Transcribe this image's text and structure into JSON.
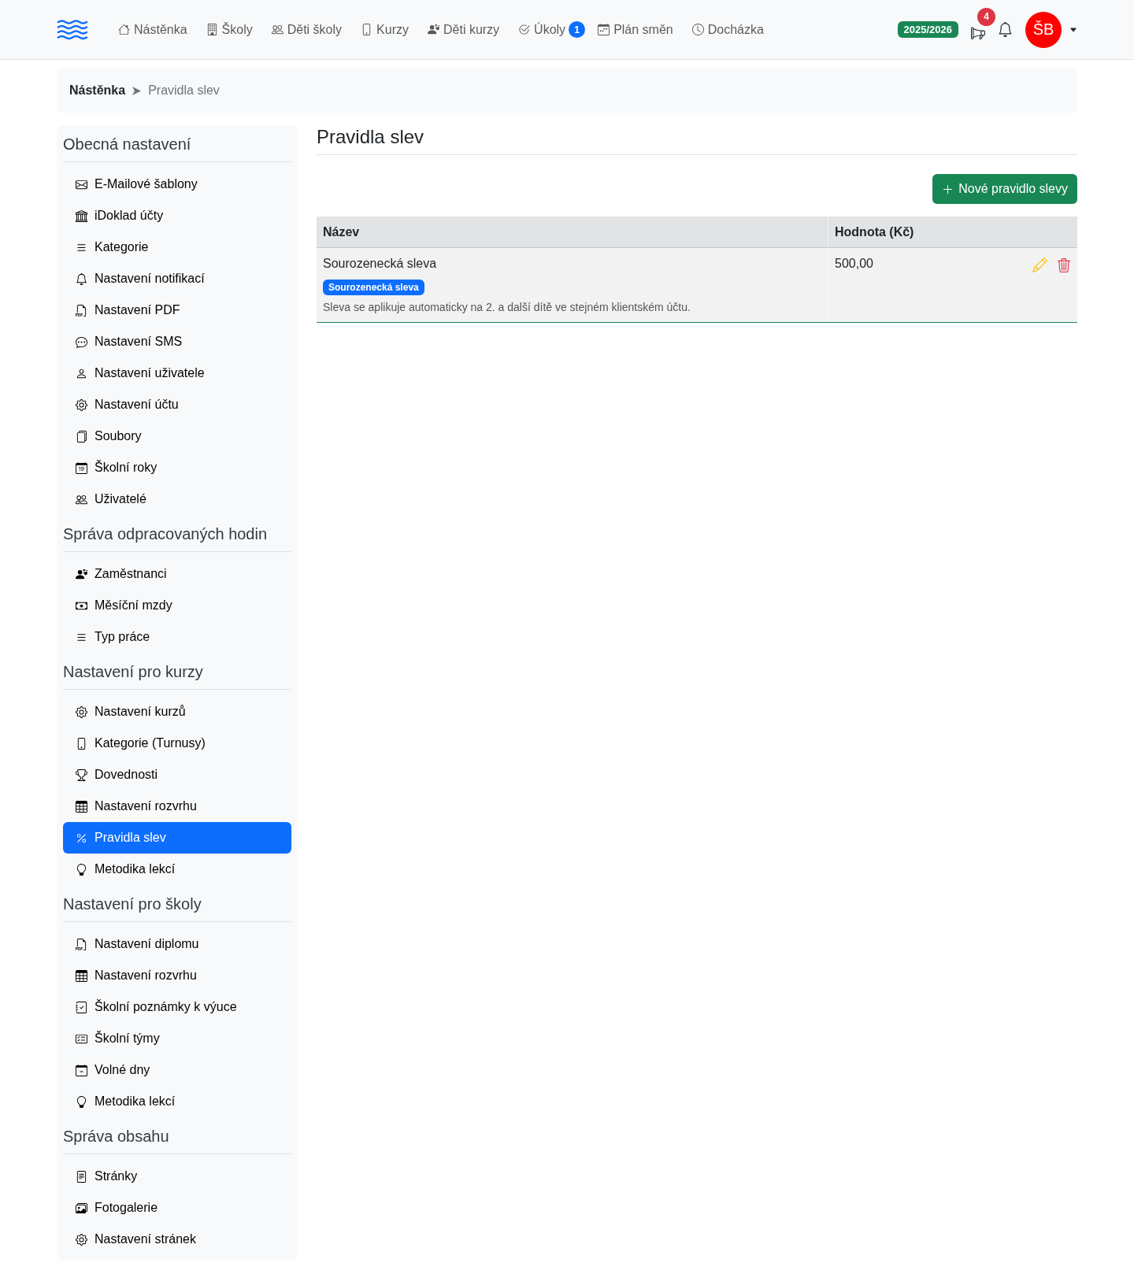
{
  "navbar": {
    "items": [
      {
        "label": "Nástěnka"
      },
      {
        "label": "Školy"
      },
      {
        "label": "Děti školy"
      },
      {
        "label": "Kurzy"
      },
      {
        "label": "Děti kurzy"
      },
      {
        "label": "Úkoly",
        "badge": "1"
      },
      {
        "label": "Plán směn"
      },
      {
        "label": "Docházka"
      }
    ],
    "school_year": "2025/2026",
    "announcements_count": "4",
    "avatar_initials": "ŠB"
  },
  "breadcrumb": [
    {
      "label": "Nástěnka",
      "active": false
    },
    {
      "label": "Pravidla slev",
      "active": true
    }
  ],
  "sidebar": {
    "sections": [
      {
        "title": "Obecná nastavení",
        "items": [
          {
            "label": "E-Mailové šablony",
            "selected": false
          },
          {
            "label": "iDoklad účty",
            "selected": false
          },
          {
            "label": "Kategorie",
            "selected": false
          },
          {
            "label": "Nastavení notifikací",
            "selected": false
          },
          {
            "label": "Nastavení PDF",
            "selected": false
          },
          {
            "label": "Nastavení SMS",
            "selected": false
          },
          {
            "label": "Nastavení uživatele",
            "selected": false
          },
          {
            "label": "Nastavení účtu",
            "selected": false
          },
          {
            "label": "Soubory",
            "selected": false
          },
          {
            "label": "Školní roky",
            "selected": false
          },
          {
            "label": "Uživatelé",
            "selected": false
          }
        ]
      },
      {
        "title": "Správa odpracovaných hodin",
        "items": [
          {
            "label": "Zaměstnanci",
            "selected": false
          },
          {
            "label": "Měsíční mzdy",
            "selected": false
          },
          {
            "label": "Typ práce",
            "selected": false
          }
        ]
      },
      {
        "title": "Nastavení pro kurzy",
        "items": [
          {
            "label": "Nastavení kurzů",
            "selected": false
          },
          {
            "label": "Kategorie (Turnusy)",
            "selected": false
          },
          {
            "label": "Dovednosti",
            "selected": false
          },
          {
            "label": "Nastavení rozvrhu",
            "selected": false
          },
          {
            "label": "Pravidla slev",
            "selected": true
          },
          {
            "label": "Metodika lekcí",
            "selected": false
          }
        ]
      },
      {
        "title": "Nastavení pro školy",
        "items": [
          {
            "label": "Nastavení diplomu",
            "selected": false
          },
          {
            "label": "Nastavení rozvrhu",
            "selected": false
          },
          {
            "label": "Školní poznámky k výuce",
            "selected": false
          },
          {
            "label": "Školní týmy",
            "selected": false
          },
          {
            "label": "Volné dny",
            "selected": false
          },
          {
            "label": "Metodika lekcí",
            "selected": false
          }
        ]
      },
      {
        "title": "Správa obsahu",
        "items": [
          {
            "label": "Stránky",
            "selected": false
          },
          {
            "label": "Fotogalerie",
            "selected": false
          },
          {
            "label": "Nastavení stránek",
            "selected": false
          }
        ]
      }
    ]
  },
  "page": {
    "title": "Pravidla slev",
    "new_button": "Nové pravidlo slevy"
  },
  "table": {
    "columns": [
      "Název",
      "Hodnota (Kč)"
    ],
    "rows": [
      {
        "name": "Sourozenecká sleva",
        "tag": "Sourozenecká sleva",
        "description": "Sleva se aplikuje automaticky na 2. a další dítě ve stejném klientském účtu.",
        "value": "500,00"
      }
    ]
  }
}
